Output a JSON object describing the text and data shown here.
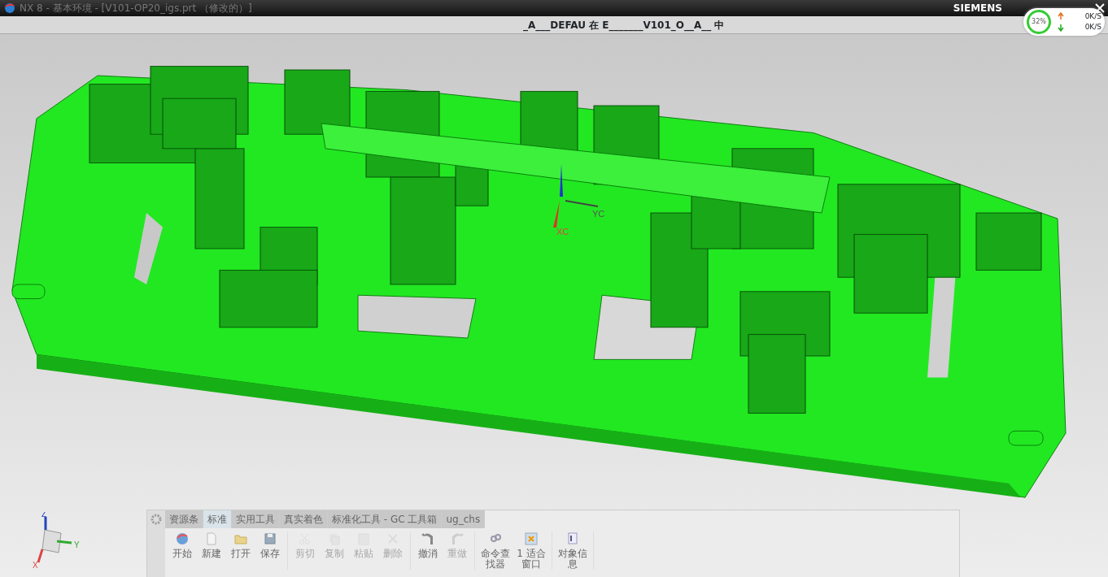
{
  "window": {
    "title": "NX 8 - 基本环境 - [V101-OP20_igs.prt （修改的）]",
    "brand": "SIEMENS"
  },
  "info_bar": {
    "text": "_A___DEFAU 在 E_______V101_O__A__ 中"
  },
  "network_monitor": {
    "percent": "32%",
    "upload": "0K/S",
    "download": "0K/S"
  },
  "viewport": {
    "wcs_labels": [
      "XC",
      "YC"
    ],
    "triad_labels": [
      "Z",
      "Y",
      "X"
    ]
  },
  "ribbon": {
    "tabs": [
      {
        "label": "资源条",
        "selected": false
      },
      {
        "label": "标准",
        "selected": true
      },
      {
        "label": "实用工具",
        "selected": false
      },
      {
        "label": "真实着色",
        "selected": false
      },
      {
        "label": "标准化工具 - GC 工具箱",
        "selected": false
      },
      {
        "label": "ug_chs",
        "selected": false
      }
    ],
    "groups": [
      [
        {
          "label": "开始",
          "kind": "start",
          "disabled": false
        },
        {
          "label": "新建",
          "kind": "new",
          "disabled": false
        },
        {
          "label": "打开",
          "kind": "open",
          "disabled": false
        },
        {
          "label": "保存",
          "kind": "save",
          "disabled": false
        }
      ],
      [
        {
          "label": "剪切",
          "kind": "cut",
          "disabled": true
        },
        {
          "label": "复制",
          "kind": "copy",
          "disabled": true
        },
        {
          "label": "粘贴",
          "kind": "paste",
          "disabled": true
        },
        {
          "label": "删除",
          "kind": "delete",
          "disabled": true
        }
      ],
      [
        {
          "label": "撤消",
          "kind": "undo",
          "disabled": false
        },
        {
          "label": "重做",
          "kind": "redo",
          "disabled": true
        }
      ],
      [
        {
          "label": "命令查找器",
          "kind": "finder",
          "disabled": false
        },
        {
          "label": "1 适合窗口",
          "kind": "fit",
          "disabled": false
        }
      ],
      [
        {
          "label": "对象信息",
          "kind": "info",
          "disabled": false
        }
      ]
    ]
  }
}
